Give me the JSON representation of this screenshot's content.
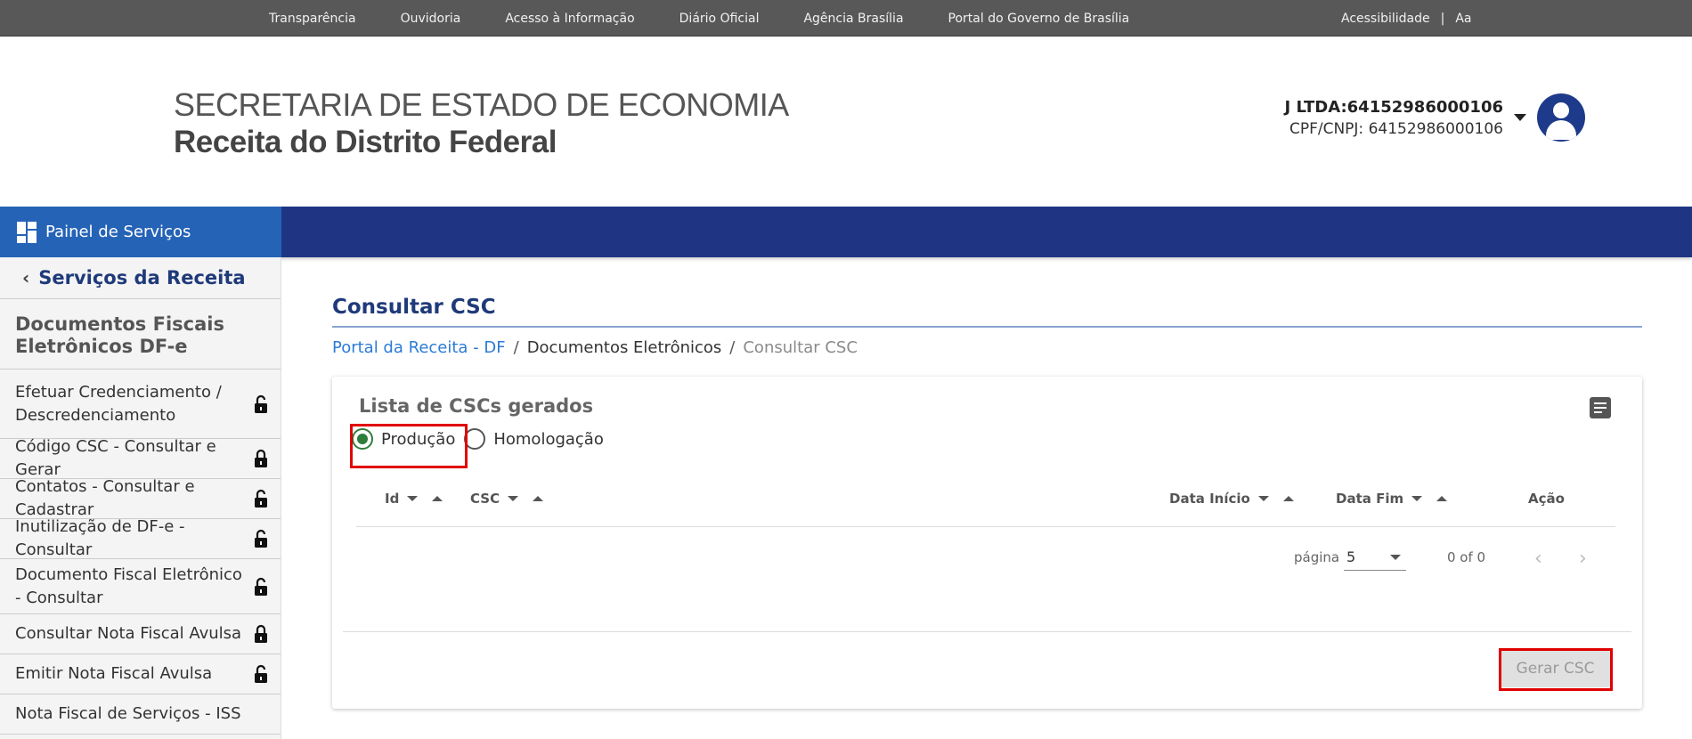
{
  "topbar": {
    "links": [
      "Transparência",
      "Ouvidoria",
      "Acesso à Informação",
      "Diário Oficial",
      "Agência Brasília",
      "Portal do Governo de Brasília"
    ],
    "accessibility": "Acessibilidade",
    "separator": "|",
    "font_size": "Aa"
  },
  "header": {
    "title_line1": "SECRETARIA DE ESTADO DE ECONOMIA",
    "title_line2": "Receita do Distrito Federal"
  },
  "user": {
    "name": "J LTDA:64152986000106",
    "document": "CPF/CNPJ: 64152986000106",
    "avatar_icon": "user-avatar-icon"
  },
  "navbar": {
    "panel_label": "Painel de Serviços",
    "colors": {
      "panel": "#2563b7",
      "bar": "#1f3584"
    }
  },
  "sidebar": {
    "back_label": "Serviços da Receita",
    "section_title": "Documentos Fiscais Eletrônicos DF-e",
    "items": [
      {
        "label": "Efetuar Credenciamento / Descredenciamento",
        "lock": "open"
      },
      {
        "label": "Código CSC - Consultar e Gerar",
        "lock": "closed"
      },
      {
        "label": "Contatos - Consultar e Cadastrar",
        "lock": "open"
      },
      {
        "label": "Inutilização de DF-e - Consultar",
        "lock": "open"
      },
      {
        "label": "Documento Fiscal Eletrônico - Consultar",
        "lock": "open"
      },
      {
        "label": "Consultar Nota Fiscal Avulsa",
        "lock": "closed"
      },
      {
        "label": "Emitir Nota Fiscal Avulsa",
        "lock": "open"
      },
      {
        "label": "Nota Fiscal de Serviços - ISS",
        "lock": "none"
      }
    ]
  },
  "main": {
    "title": "Consultar CSC",
    "breadcrumb": [
      "Portal da Receita - DF",
      "Documentos Eletrônicos",
      "Consultar CSC"
    ],
    "breadcrumb_sep": "/",
    "card_title": "Lista de CSCs gerados",
    "radios": [
      {
        "label": "Produção",
        "checked": true
      },
      {
        "label": "Homologação",
        "checked": false
      }
    ],
    "columns": [
      "Id",
      "CSC",
      "Data Início",
      "Data Fim",
      "Ação"
    ],
    "pager": {
      "page_label": "página",
      "page_size": "5",
      "range": "0 of 0"
    },
    "generate_button": "Gerar CSC",
    "highlight_color": "#e00000"
  }
}
